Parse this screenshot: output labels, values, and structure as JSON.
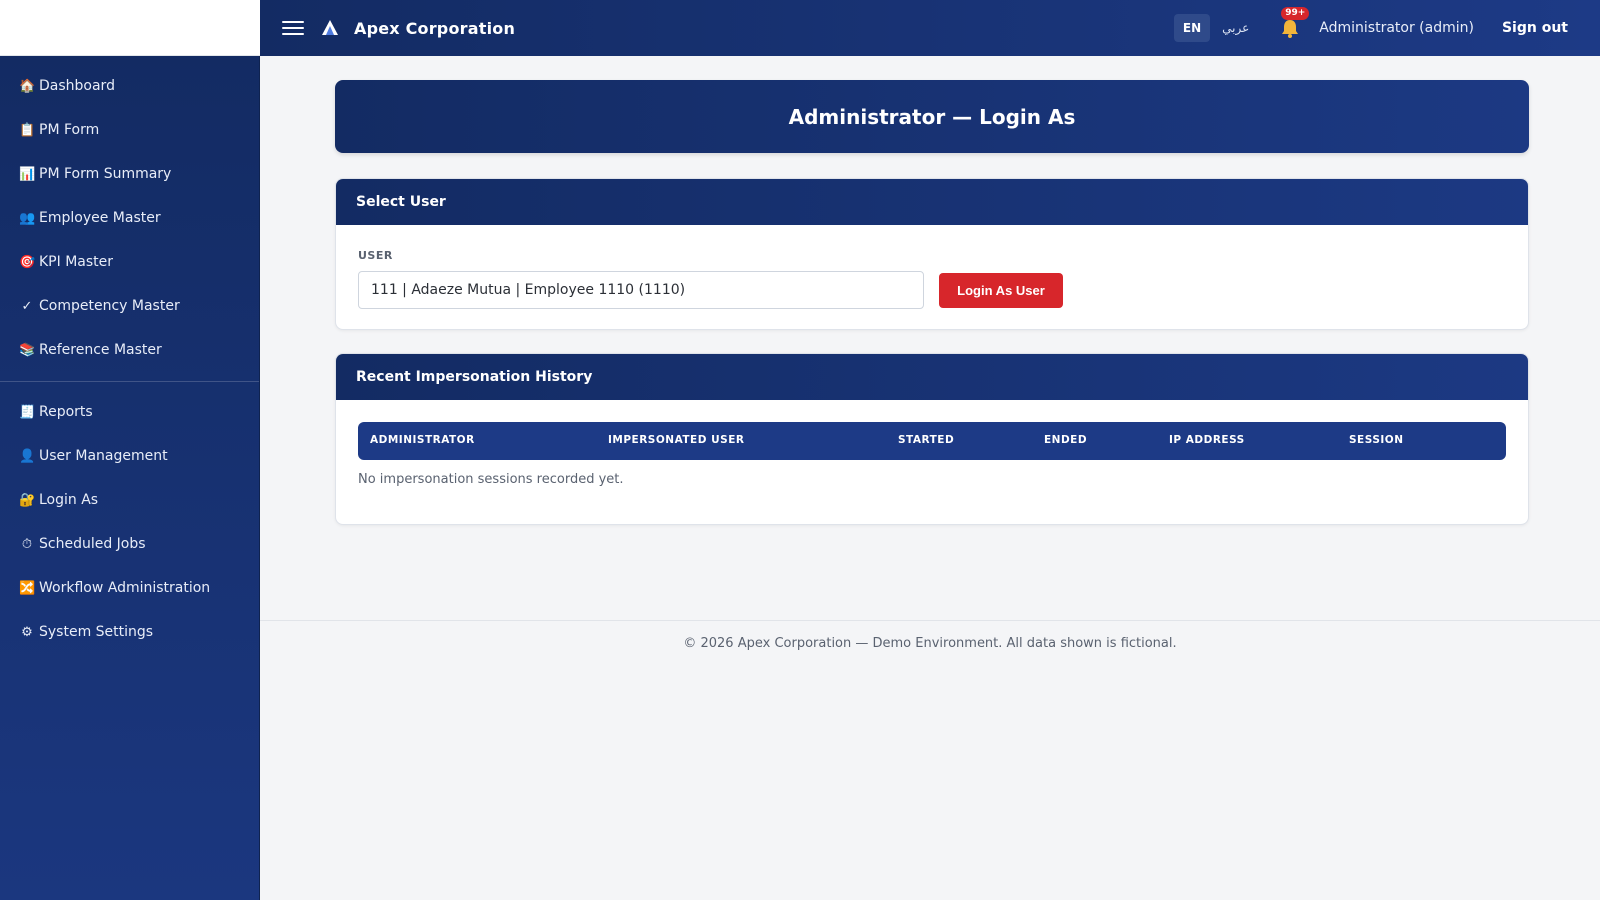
{
  "header": {
    "brand": "Apex Corporation",
    "lang_en": "EN",
    "lang_ar": "عربي",
    "notification_count": "99+",
    "user": "Administrator (admin)",
    "sign_out": "Sign out"
  },
  "sidebar": {
    "items": [
      {
        "icon": "🏠",
        "icon_name": "home-icon",
        "label": "Dashboard"
      },
      {
        "icon": "📋",
        "icon_name": "clipboard-icon",
        "label": "PM Form"
      },
      {
        "icon": "📊",
        "icon_name": "bar-chart-icon",
        "label": "PM Form Summary"
      },
      {
        "icon": "👥",
        "icon_name": "users-icon",
        "label": "Employee Master"
      },
      {
        "icon": "🎯",
        "icon_name": "target-icon",
        "label": "KPI Master"
      },
      {
        "icon": "✓",
        "icon_name": "check-icon",
        "label": "Competency Master"
      },
      {
        "icon": "📚",
        "icon_name": "books-icon",
        "label": "Reference Master"
      }
    ],
    "admin_items": [
      {
        "icon": "🧾",
        "icon_name": "receipt-icon",
        "label": "Reports"
      },
      {
        "icon": "👤",
        "icon_name": "user-icon",
        "label": "User Management"
      },
      {
        "icon": "🔐",
        "icon_name": "lock-key-icon",
        "label": "Login As"
      },
      {
        "icon": "⏱",
        "icon_name": "stopwatch-icon",
        "label": "Scheduled Jobs"
      },
      {
        "icon": "🔀",
        "icon_name": "shuffle-icon",
        "label": "Workflow Administration"
      },
      {
        "icon": "⚙",
        "icon_name": "gear-icon",
        "label": "System Settings"
      }
    ]
  },
  "page": {
    "title": "Administrator — Login As"
  },
  "select_user": {
    "header": "Select User",
    "field_label": "USER",
    "selected_value": "111 | Adaeze Mutua | Employee 1110 (1110)",
    "button_label": "Login As User"
  },
  "history": {
    "header": "Recent Impersonation History",
    "columns": [
      "ADMINISTRATOR",
      "IMPERSONATED USER",
      "STARTED",
      "ENDED",
      "IP ADDRESS",
      "SESSION"
    ],
    "empty_message": "No impersonation sessions recorded yet."
  },
  "footer": {
    "text": "© 2026 Apex Corporation — Demo Environment. All data shown is fictional."
  },
  "colors": {
    "navy": "#132b63",
    "navy_light": "#1d3a86",
    "danger": "#d7262b"
  }
}
